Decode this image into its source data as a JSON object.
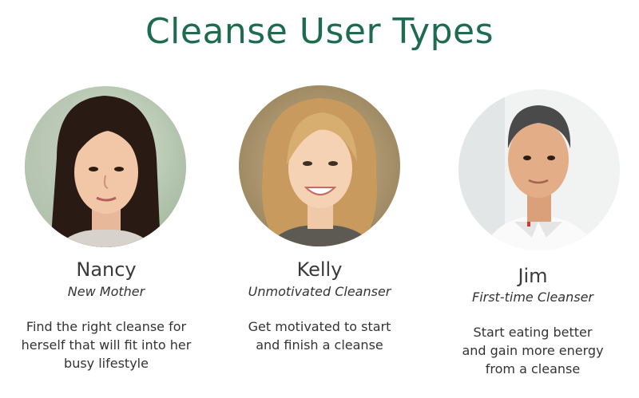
{
  "page": {
    "title": "Cleanse User Types"
  },
  "personas": [
    {
      "name": "Nancy",
      "role": "New Mother",
      "description_lines": [
        "Find the right cleanse for",
        "herself that will fit into her",
        "busy lifestyle"
      ]
    },
    {
      "name": "Kelly",
      "role": "Unmotivated Cleanser",
      "description_lines": [
        "Get motivated to start",
        "and finish a cleanse"
      ]
    },
    {
      "name": "Jim",
      "role": "First-time Cleanser",
      "description_lines": [
        "Start eating better",
        "and gain more energy",
        "from a cleanse"
      ]
    }
  ],
  "colors": {
    "title": "#1f6b4f",
    "text": "#333333"
  }
}
